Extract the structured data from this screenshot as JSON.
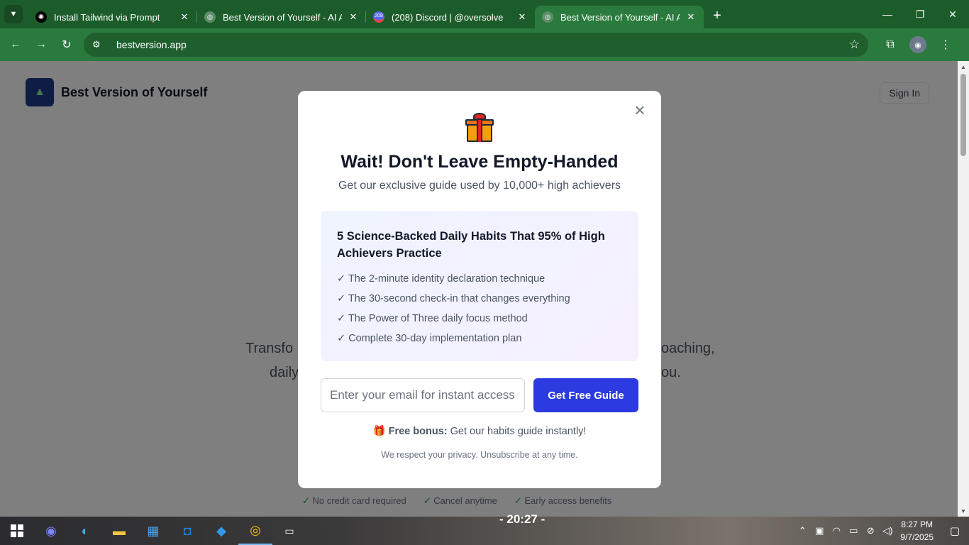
{
  "browser": {
    "tabs": [
      {
        "title": "Install Tailwind via Prompt",
        "favicon": "chatgpt-icon",
        "active": false
      },
      {
        "title": "Best Version of Yourself - AI Ac",
        "favicon": "globe-icon",
        "active": false
      },
      {
        "title": "(208) Discord | @oversolve",
        "favicon": "discord-icon",
        "badge": "208",
        "active": false
      },
      {
        "title": "Best Version of Yourself - AI Ac",
        "favicon": "globe-icon",
        "active": true
      }
    ],
    "url": "bestversion.app",
    "accent": "#2a7a3d",
    "frame_color": "#1c5c2a"
  },
  "page": {
    "site_name": "Best Version of Yourself",
    "signin_label": "Sign In",
    "hero_line1": "Transfo",
    "hero_line1_right": "oaching,",
    "hero_line2": "daily",
    "hero_line2_right": "ou.",
    "features": [
      "No credit card required",
      "Cancel anytime",
      "Early access benefits"
    ]
  },
  "modal": {
    "title": "Wait! Don't Leave Empty-Handed",
    "subtitle": "Get our exclusive guide used by 10,000+ high achievers",
    "guide": {
      "title": "5 Science-Backed Daily Habits That 95% of High Achievers Practice",
      "items": [
        "✓ The 2-minute identity declaration technique",
        "✓ The 30-second check-in that changes everything",
        "✓ The Power of Three daily focus method",
        "✓ Complete 30-day implementation plan"
      ]
    },
    "email_placeholder": "Enter your email for instant access",
    "cta_label": "Get Free Guide",
    "cta_color": "#2b3be0",
    "bonus_label": "Free bonus:",
    "bonus_text": " Get our habits guide instantly!",
    "privacy": "We respect your privacy. Unsubscribe at any time."
  },
  "taskbar": {
    "center_text": "- 20:27 -",
    "time": "8:27 PM",
    "date": "9/7/2025"
  }
}
